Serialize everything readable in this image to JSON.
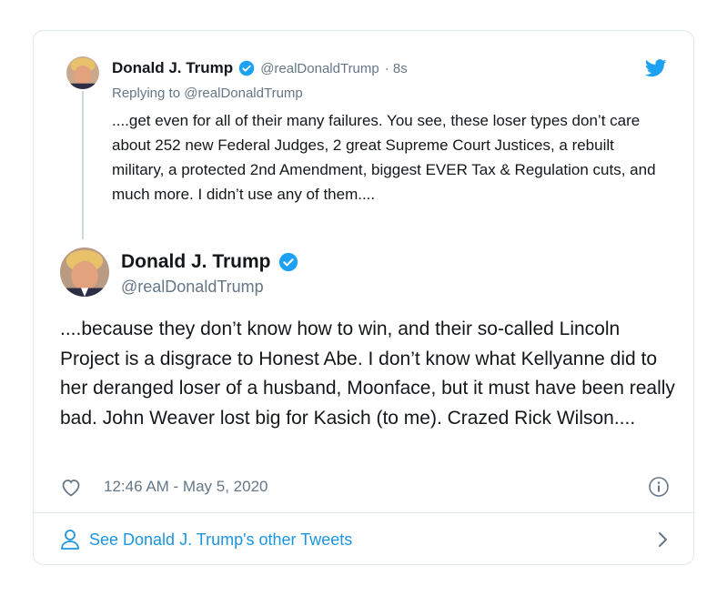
{
  "colors": {
    "blue": "#1da1f2",
    "link": "#1b95e0",
    "muted": "#657786",
    "text": "#14171a",
    "border": "#e1e8ed"
  },
  "reply": {
    "name": "Donald J. Trump",
    "handle": "@realDonaldTrump",
    "time_ago": "· 8s",
    "replying_to": "Replying to @realDonaldTrump",
    "text": "....get even for all of their many failures. You see, these loser types don’t care about 252 new Federal Judges, 2 great Supreme Court Justices, a rebuilt military, a protected 2nd Amendment, biggest EVER Tax & Regulation cuts, and much more. I didn’t use any of them...."
  },
  "tweet": {
    "name": "Donald J. Trump",
    "handle": "@realDonaldTrump",
    "text": "....because they don’t know how to win, and their so-called Lincoln Project is a disgrace to Honest Abe. I don’t know what Kellyanne did to her deranged loser of a husband, Moonface, but it must have been really bad. John Weaver lost big for Kasich (to me). Crazed Rick Wilson....",
    "timestamp": "12:46 AM - May 5, 2020"
  },
  "footer": {
    "see_more_label": "See Donald J. Trump's other Tweets"
  },
  "icons": {
    "verified": "verified-badge-icon",
    "bird": "twitter-bird-icon",
    "like": "heart-icon",
    "info": "info-icon",
    "person": "person-icon",
    "chevron": "chevron-right-icon"
  }
}
